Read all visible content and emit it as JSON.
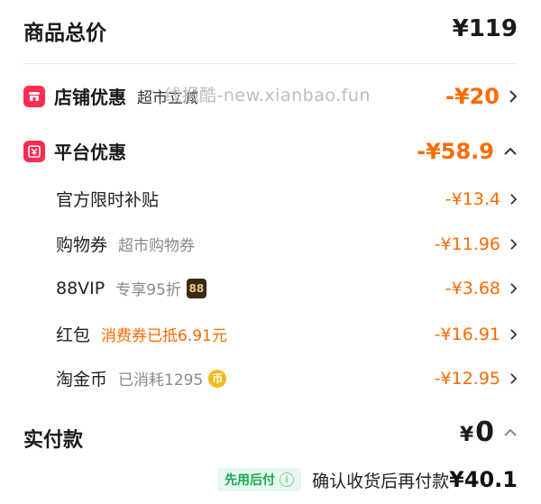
{
  "total": {
    "label": "商品总价",
    "value": "¥119"
  },
  "watermark": "线报酷-new.xianbao.fun",
  "store_discount": {
    "title": "店铺优惠",
    "subtitle": "超市立减",
    "amount": "-¥20"
  },
  "platform_discount": {
    "title": "平台优惠",
    "amount": "-¥58.9",
    "items": [
      {
        "label": "官方限时补贴",
        "sub": "",
        "amount": "-¥13.4"
      },
      {
        "label": "购物券",
        "sub": "超市购物券",
        "amount": "-¥11.96"
      },
      {
        "label": "88VIP",
        "sub": "专享95折",
        "badge": "88",
        "amount": "-¥3.68"
      },
      {
        "label": "红包",
        "sub": "消费券已抵6.91元",
        "amount": "-¥16.91"
      },
      {
        "label": "淘金币",
        "sub": "已消耗1295",
        "coin": "币",
        "amount": "-¥12.95"
      }
    ]
  },
  "actual_payment": {
    "label": "实付款",
    "currency": "¥",
    "value": "0"
  },
  "bottom": {
    "tag": "先用后付",
    "info": "i",
    "text": "确认收货后再付款",
    "amount": "¥40.1"
  },
  "colors": {
    "accent": "#ff6a00",
    "badge_red": "#ff2b52",
    "green": "#17a852"
  }
}
